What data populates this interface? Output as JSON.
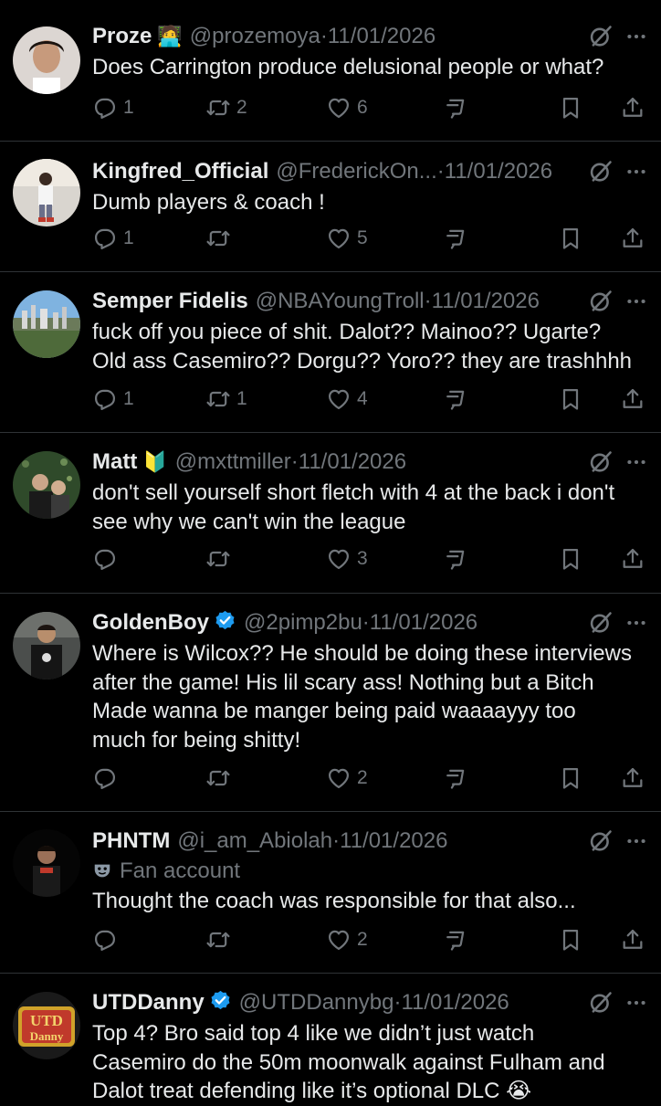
{
  "tweets": [
    {
      "name": "Proze",
      "badge": "🧑‍💻",
      "handle": "@prozemoya",
      "sep": "·",
      "date": "11/01/2026",
      "lines": [
        "Does Carrington produce delusional people or what?"
      ],
      "counts": {
        "reply": "1",
        "retweet": "2",
        "like": "6"
      }
    },
    {
      "name": "Kingfred_Official",
      "badge": "",
      "handle": "@FrederickOn...",
      "sep": "·",
      "date": "11/01/2026",
      "lines": [
        "Dumb players & coach !"
      ],
      "counts": {
        "reply": "1",
        "retweet": "",
        "like": "5"
      }
    },
    {
      "name": "Semper Fidelis",
      "badge": "",
      "handle": "@NBAYoungTroll",
      "sep": "·",
      "date": "11/01/2026",
      "lines": [
        "fuck off you piece of shit. Dalot?? Mainoo?? Ugarte?",
        "Old ass Casemiro?? Dorgu?? Yoro?? they are trashhhh"
      ],
      "counts": {
        "reply": "1",
        "retweet": "1",
        "like": "4"
      }
    },
    {
      "name": "Matt",
      "badge": "🔰",
      "handle": "@mxttmiller",
      "sep": "·",
      "date": "11/01/2026",
      "lines": [
        "don't sell yourself short fletch with 4 at the back i don't",
        "see why we can't win the league"
      ],
      "counts": {
        "reply": "",
        "retweet": "",
        "like": "3"
      }
    },
    {
      "name": "GoldenBoy",
      "badge": "",
      "verified": true,
      "handle": "@2pimp2bu",
      "sep": "·",
      "date": "11/01/2026",
      "lines": [
        "Where is Wilcox?? He should be doing these interviews",
        "after the game!  His lil scary ass! Nothing but a Bitch",
        "Made wanna be manger being paid waaaayyy too",
        "much for being shitty!"
      ],
      "counts": {
        "reply": "",
        "retweet": "",
        "like": "2"
      }
    },
    {
      "name": "PHNTM",
      "badge": "",
      "handle": "@i_am_Abiolah",
      "sep": "·",
      "date": "11/01/2026",
      "fan_label": "Fan account",
      "lines": [
        "Thought the coach was responsible for that also..."
      ],
      "counts": {
        "reply": "",
        "retweet": "",
        "like": "2"
      }
    },
    {
      "name": "UTDDanny",
      "badge": "",
      "verified": true,
      "handle": "@UTDDannybg",
      "sep": "·",
      "date": "11/01/2026",
      "lines": [
        "Top 4? Bro said top 4 like we didn’t just watch",
        "Casemiro do the 50m moonwalk against Fulham and",
        "Dalot treat defending like it’s optional DLC 😭"
      ],
      "avatar_text": "UTD Danny",
      "counts": {
        "reply": "",
        "retweet": "",
        "like": ""
      }
    }
  ],
  "colors": {
    "background": "#000000",
    "text": "#e7e9ea",
    "muted": "#71767b",
    "divider": "#2f3336",
    "verified": "#1d9bf0"
  },
  "icons": [
    "reply-icon",
    "retweet-icon",
    "like-icon",
    "grok-icon",
    "bookmark-icon",
    "share-icon",
    "more-icon",
    "verified-icon",
    "mask-icon"
  ]
}
